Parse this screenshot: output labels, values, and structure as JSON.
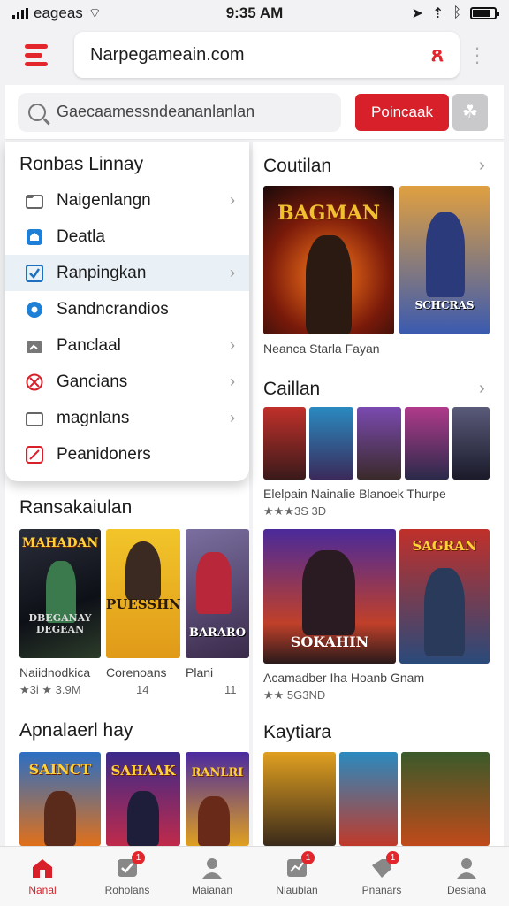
{
  "status_bar": {
    "carrier": "eageas",
    "time": "9:35 AM"
  },
  "browser": {
    "url": "Narpegameain.com"
  },
  "search": {
    "placeholder": "Gaecaamessndeananlanlan",
    "primary_button": "Poincaak"
  },
  "menu": {
    "title": "Ronbas Linnay",
    "items": [
      {
        "label": "Naigenlangn",
        "icon": "folder-icon",
        "chevron": true
      },
      {
        "label": "Deatla",
        "icon": "home-icon",
        "chevron": false
      },
      {
        "label": "Ranpingkan",
        "icon": "checkbox-icon",
        "chevron": true,
        "active": true
      },
      {
        "label": "Sandncrandios",
        "icon": "gear-badge-icon",
        "chevron": false
      },
      {
        "label": "Panclaal",
        "icon": "folder-chart-icon",
        "chevron": true
      },
      {
        "label": "Gancians",
        "icon": "blocked-icon",
        "chevron": true
      },
      {
        "label": "magnlans",
        "icon": "folder-icon",
        "chevron": true
      },
      {
        "label": "Peanidoners",
        "icon": "blocked-square-icon",
        "chevron": false
      }
    ]
  },
  "left_sections": {
    "section1": {
      "title": "Ransakaiulan",
      "cards": [
        {
          "art": "MAHADAN",
          "art_sub": "DBEGANAY DEGEAN",
          "caption": "Naiidnodkica",
          "meta": "★3i ★ 3.9M"
        },
        {
          "art": "PUESSHNY",
          "caption": "Corenoans",
          "meta": "14"
        },
        {
          "art": "BARARO",
          "caption": "Plani",
          "meta": "11"
        }
      ]
    },
    "section2": {
      "title": "Apnalaerl hay",
      "cards": [
        {
          "art": "SAINCT"
        },
        {
          "art": "SAHAAK"
        },
        {
          "art": "RANLRI"
        }
      ]
    }
  },
  "right_sections": {
    "section1": {
      "title": "Coutilan",
      "cards": [
        {
          "art": "BAGMAN"
        },
        {
          "art": "SCHCRAS"
        }
      ],
      "caption": "Neanca Starla Fayan"
    },
    "section2": {
      "title": "Caillan",
      "caption": "Elelpain Nainalie  Blanoek  Thurpe",
      "meta": "★★★3S 3D"
    },
    "section3": {
      "cards": [
        {
          "art": "SOKAHIN"
        },
        {
          "art": "SAGRAN"
        }
      ],
      "caption": "Acamadber Iha Hoanb  Gnam",
      "meta": "★★ 5G3ND"
    },
    "section4": {
      "title": "Kaytiara"
    }
  },
  "bottom_nav": [
    {
      "label": "Nanal",
      "icon": "home-icon",
      "active": true
    },
    {
      "label": "Roholans",
      "icon": "shield-check-icon",
      "badge": "1"
    },
    {
      "label": "Maianan",
      "icon": "person-icon"
    },
    {
      "label": "Nlaublan",
      "icon": "chart-icon",
      "badge": "1"
    },
    {
      "label": "Pnanars",
      "icon": "tag-icon",
      "badge": "1"
    },
    {
      "label": "Deslana",
      "icon": "person-icon"
    }
  ],
  "colors": {
    "accent": "#d8202a",
    "menu_highlight": "#e9f0f6"
  }
}
